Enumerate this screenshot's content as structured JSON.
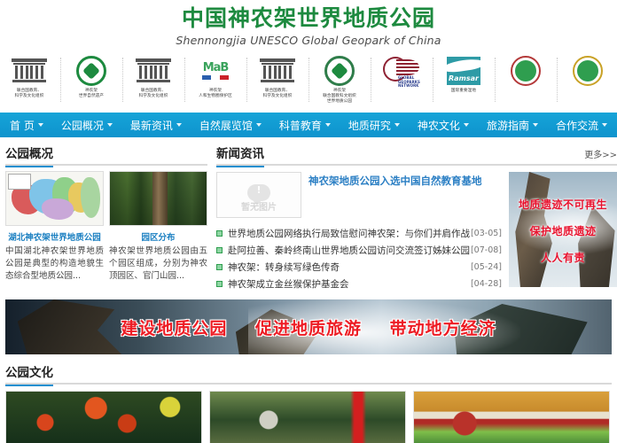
{
  "header": {
    "title_cn": "中国神农架世界地质公园",
    "title_en": "Shennongjia UNESCO Global Geopark of China",
    "logos": [
      {
        "name": "unesco-temple-logo",
        "caption": "联合国教育、\n科学及文化组织"
      },
      {
        "name": "shennongjia-natural-heritage-logo",
        "caption": "神农架\n世界自然遗产"
      },
      {
        "name": "unesco-temple-logo-2",
        "caption": "联合国教育、\n科学及文化组织"
      },
      {
        "name": "mab-biosphere-logo",
        "caption": "神农架\n人和生物圈保护区"
      },
      {
        "name": "unesco-temple-logo-3",
        "caption": "联合国教育、\n科学及文化组织"
      },
      {
        "name": "global-geoparks-network-logo",
        "caption": "神农架\n联合国教科文组织\n世界地质公园"
      },
      {
        "name": "ggn-network-logo",
        "caption": ""
      },
      {
        "name": "ramsar-logo",
        "caption": "国际重要湿地"
      },
      {
        "name": "china-emblem-logo",
        "caption": ""
      },
      {
        "name": "china-emblem-gold-logo",
        "caption": ""
      }
    ]
  },
  "nav": {
    "items": [
      {
        "label": "首 页",
        "caret": true
      },
      {
        "label": "公园概况",
        "caret": true
      },
      {
        "label": "最新资讯",
        "caret": true
      },
      {
        "label": "自然展览馆",
        "caret": true
      },
      {
        "label": "科普教育",
        "caret": true
      },
      {
        "label": "地质研究",
        "caret": true
      },
      {
        "label": "神农文化",
        "caret": true
      },
      {
        "label": "旅游指南",
        "caret": true
      },
      {
        "label": "合作交流",
        "caret": true
      }
    ]
  },
  "overview": {
    "section_title": "公园概况",
    "cards": [
      {
        "caption": "湖北神农架世界地质公园",
        "desc": "中国湖北神农架世界地质公园是典型的构造地貌生态综合型地质公园..."
      },
      {
        "caption": "园区分布",
        "desc": "神农架世界地质公园由五个园区组成，分别为神农顶园区、官门山园..."
      }
    ]
  },
  "news": {
    "section_title": "新闻资讯",
    "more_label": "更多>>",
    "placeholder_text": "暂无图片",
    "lead_title": "神农架地质公园入选中国自然教育基地",
    "items": [
      {
        "title": "世界地质公园网络执行局致信慰问神农架：与你们并肩作战",
        "date": "[03-05]"
      },
      {
        "title": "赴阿拉善、秦岭终南山世界地质公园访问交流签订姊妹公园",
        "date": "[07-08]"
      },
      {
        "title": "神农架：转身续写绿色传奇",
        "date": "[05-24]"
      },
      {
        "title": "神农架成立金丝猴保护基金会",
        "date": "[04-28]"
      }
    ]
  },
  "promo": {
    "lines": [
      "地质遗迹不可再生",
      "保护地质遗迹",
      "人人有责"
    ],
    "text_color": "#e8112d"
  },
  "banner": {
    "slogans": [
      "建设地质公园",
      "促进地质旅游",
      "带动地方经济"
    ],
    "text_color": "#ed1c24"
  },
  "culture": {
    "section_title": "公园文化",
    "cards": [
      {
        "name": "autumn-foliage-photo"
      },
      {
        "name": "mountain-temple-photo"
      },
      {
        "name": "folk-opera-photo"
      }
    ]
  },
  "colors": {
    "brand_green": "#1d8a3f",
    "nav_blue": "#0e93cd",
    "accent_blue": "#1a8fd0",
    "link_blue": "#2b7fc4",
    "promo_red": "#e8112d"
  }
}
